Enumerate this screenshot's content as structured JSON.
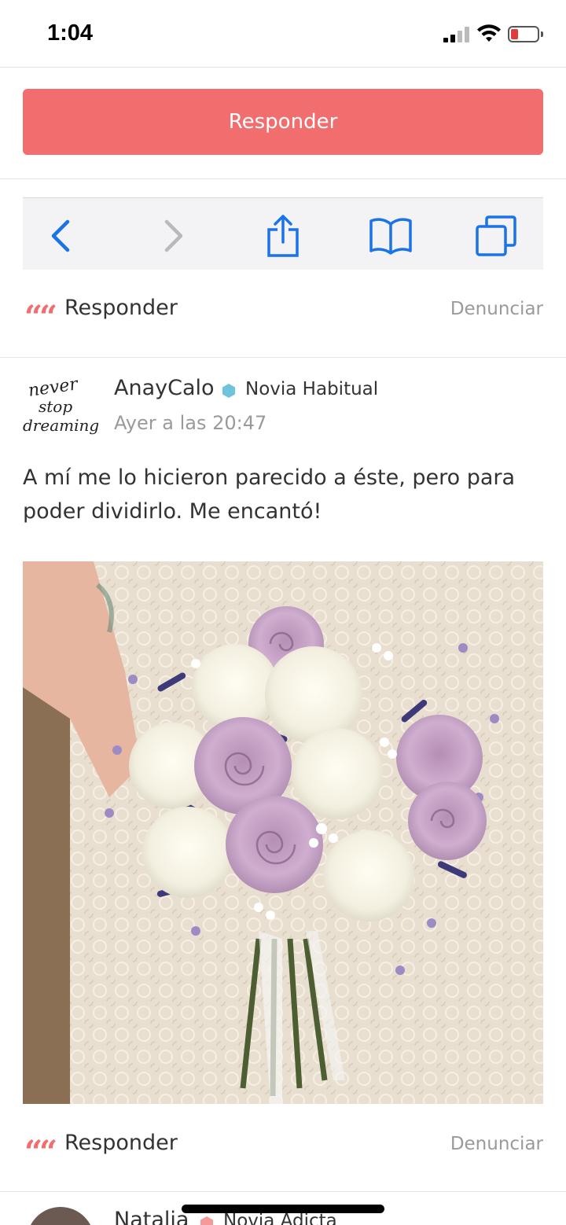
{
  "status_bar": {
    "time": "1:04",
    "icons": [
      "signal-icon",
      "wifi-icon",
      "battery-icon"
    ]
  },
  "reply_button_label": "Responder",
  "browser_toolbar": {
    "icons": [
      "back-icon",
      "forward-icon",
      "share-icon",
      "bookmarks-icon",
      "tabs-icon"
    ],
    "accent_color": "#1a73e8"
  },
  "first_actions": {
    "reply_label": "Responder",
    "report_label": "Denunciar"
  },
  "post": {
    "avatar_text": "never stop dreaming",
    "username": "AnayCalo",
    "badge": "Novia Habitual",
    "badge_color": "#6fc3dc",
    "timestamp": "Ayer a las 20:47",
    "body": "A mí me lo hicieron parecido a éste, pero para poder dividirlo. Me encantó!",
    "image": "bouquet-photo",
    "reply_label": "Responder",
    "report_label": "Denunciar"
  },
  "next_post": {
    "username": "Natalia",
    "badge": "Novia Adicta",
    "badge_color": "#f26d6d"
  },
  "colors": {
    "accent": "#f26d6d",
    "muted_text": "#9a9a9a"
  }
}
